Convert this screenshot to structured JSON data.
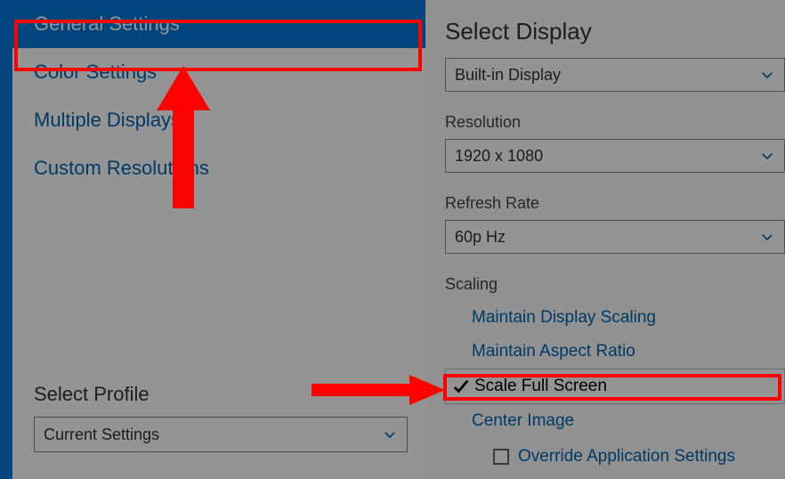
{
  "sidebar": {
    "items": [
      {
        "label": "General Settings",
        "selected": true
      },
      {
        "label": "Color Settings",
        "selected": false
      },
      {
        "label": "Multiple Displays",
        "selected": false
      },
      {
        "label": "Custom Resolutions",
        "selected": false
      }
    ],
    "profile_label": "Select Profile",
    "profile_value": "Current Settings"
  },
  "panel": {
    "select_display_label": "Select Display",
    "select_display_value": "Built-in Display",
    "resolution_label": "Resolution",
    "resolution_value": "1920 x 1080",
    "refresh_label": "Refresh Rate",
    "refresh_value": "60p Hz",
    "scaling_label": "Scaling",
    "scaling_options": [
      {
        "label": "Maintain Display Scaling",
        "selected": false
      },
      {
        "label": "Maintain Aspect Ratio",
        "selected": false
      },
      {
        "label": "Scale Full Screen",
        "selected": true
      },
      {
        "label": "Center Image",
        "selected": false
      }
    ],
    "override_label": "Override Application Settings",
    "override_checked": false
  },
  "annotations": {
    "highlight_nav": "General Settings",
    "highlight_scaling": "Scale Full Screen"
  }
}
